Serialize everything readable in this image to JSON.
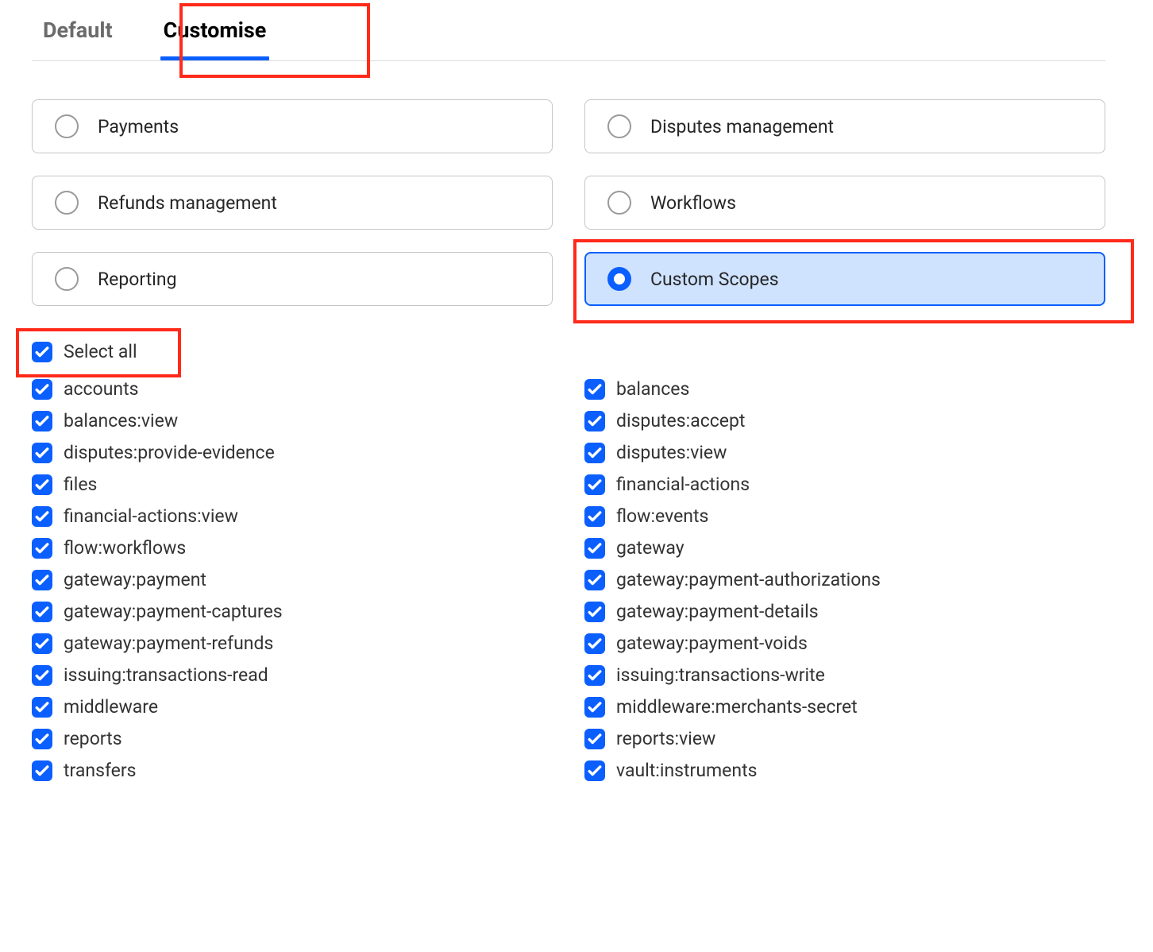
{
  "tabs": {
    "default": "Default",
    "customise": "Customise"
  },
  "radios": {
    "payments": "Payments",
    "disputes": "Disputes management",
    "refunds": "Refunds management",
    "workflows": "Workflows",
    "reporting": "Reporting",
    "custom": "Custom Scopes"
  },
  "select_all": "Select all",
  "scopes_left": [
    "accounts",
    "balances:view",
    "disputes:provide-evidence",
    "files",
    "financial-actions:view",
    "flow:workflows",
    "gateway:payment",
    "gateway:payment-captures",
    "gateway:payment-refunds",
    "issuing:transactions-read",
    "middleware",
    "reports",
    "transfers"
  ],
  "scopes_right": [
    "balances",
    "disputes:accept",
    "disputes:view",
    "financial-actions",
    "flow:events",
    "gateway",
    "gateway:payment-authorizations",
    "gateway:payment-details",
    "gateway:payment-voids",
    "issuing:transactions-write",
    "middleware:merchants-secret",
    "reports:view",
    "vault:instruments"
  ]
}
